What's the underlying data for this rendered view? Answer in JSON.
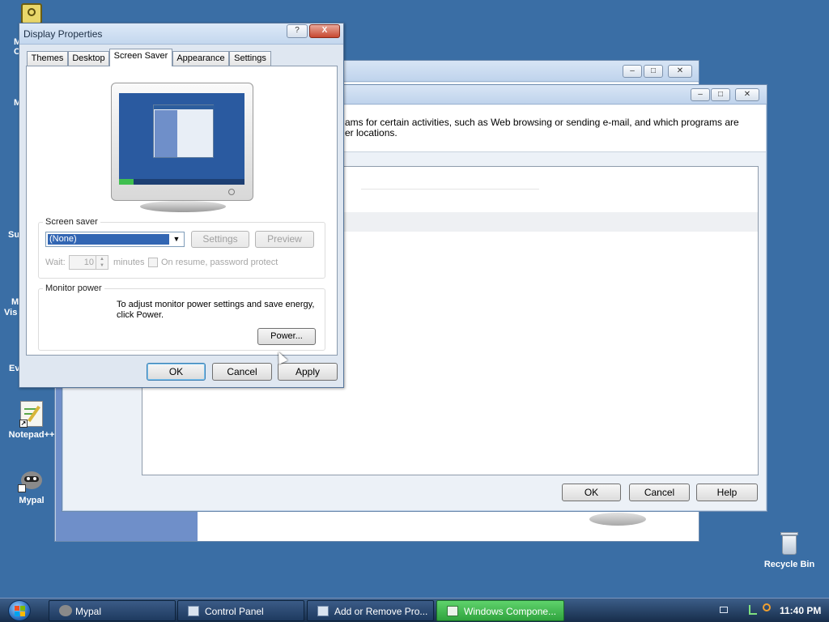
{
  "desktop": {
    "icons": [
      {
        "name": "Notepad++",
        "key": "notepad"
      },
      {
        "name": "Mypal",
        "key": "mypal"
      },
      {
        "name": "Recycle Bin",
        "key": "recycle"
      }
    ],
    "fragments": [
      "M",
      "C",
      "M",
      "Su",
      "M",
      "Vis",
      "Ev"
    ]
  },
  "back_window": {
    "description_line1": "ams for certain activities, such as Web browsing or sending e-mail, and which programs are",
    "description_line2": "er locations.",
    "buttons": {
      "ok": "OK",
      "cancel": "Cancel",
      "help": "Help"
    }
  },
  "display_properties": {
    "title": "Display Properties",
    "help_btn": "?",
    "close_btn": "X",
    "tabs": [
      "Themes",
      "Desktop",
      "Screen Saver",
      "Appearance",
      "Settings"
    ],
    "active_tab": "Screen Saver",
    "screen_saver": {
      "group_label": "Screen saver",
      "selected": "(None)",
      "settings_btn": "Settings",
      "preview_btn": "Preview",
      "wait_label": "Wait:",
      "wait_value": "10",
      "minutes_label": "minutes",
      "password_label": "On resume, password protect"
    },
    "monitor_power": {
      "group_label": "Monitor power",
      "text_line1": "To adjust monitor power settings and save energy,",
      "text_line2": "click Power.",
      "power_btn": "Power..."
    },
    "buttons": {
      "ok": "OK",
      "cancel": "Cancel",
      "apply": "Apply"
    }
  },
  "taskbar": {
    "items": [
      "Mypal",
      "Control Panel",
      "Add or Remove Pro...",
      "Windows Compone..."
    ],
    "active_item": "Windows Compone...",
    "clock": "11:40 PM"
  },
  "colors": {
    "desktop": "#3a6ea5",
    "taskbar": "#1f3a5c",
    "active_task": "#3fbf4f"
  }
}
